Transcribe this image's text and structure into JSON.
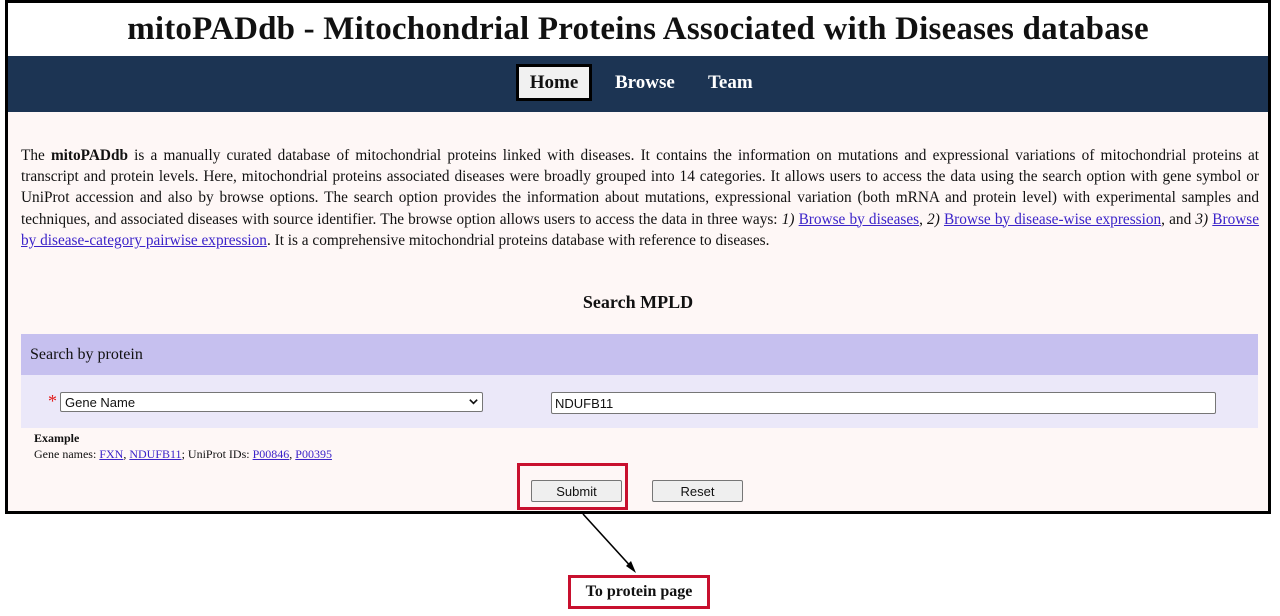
{
  "header": {
    "title": "mitoPADdb - Mitochondrial Proteins Associated with Diseases database"
  },
  "nav": {
    "items": [
      {
        "label": "Home",
        "active": true
      },
      {
        "label": "Browse"
      },
      {
        "label": "Team"
      }
    ]
  },
  "intro": {
    "t1": "The ",
    "name": "mitoPADdb",
    "t2": " is a manually curated database of mitochondrial proteins linked with diseases. It contains the information on mutations and expressional variations of mitochondrial proteins at transcript and protein levels. Here, mitochondrial proteins associated diseases were broadly grouped into 14 categories. It allows users to access the data using the search option with gene symbol or UniProt accession and also by browse options. The search option provides the information about mutations, expressional variation (both mRNA and protein level) with experimental samples and techniques, and associated diseases with source identifier. The browse option allows users to access the data in three ways: ",
    "n1": "1)",
    "link1": "Browse by diseases",
    "sep1": ", ",
    "n2": "2)",
    "link2": "Browse by disease-wise expression",
    "sep2": ", and ",
    "n3": "3)",
    "link3": "Browse by disease-category pairwise expression",
    "t3": ". It is a comprehensive mitochondrial proteins database with reference to diseases."
  },
  "search": {
    "title": "Search MPLD",
    "panel_label": "Search by protein",
    "required_marker": "*",
    "select_value": "Gene Name",
    "input_value": "NDUFB11",
    "example_heading": "Example",
    "gene_prefix": "Gene names: ",
    "gene1": "FXN",
    "gene_sep": ", ",
    "gene2": "NDUFB11",
    "uniprot_prefix": "; UniProt IDs: ",
    "uniprot1": "P00846",
    "uniprot_sep": ", ",
    "uniprot2": "P00395",
    "submit_label": "Submit",
    "reset_label": "Reset"
  },
  "annotation": {
    "callout": "To protein page",
    "highlight_color": "#c8102e"
  },
  "colors": {
    "navbar": "#1c3453",
    "panel_header": "#c6c0ef",
    "panel_body": "#ebe8f9",
    "page_bg": "#fef7f6",
    "link": "#3b23c9"
  }
}
